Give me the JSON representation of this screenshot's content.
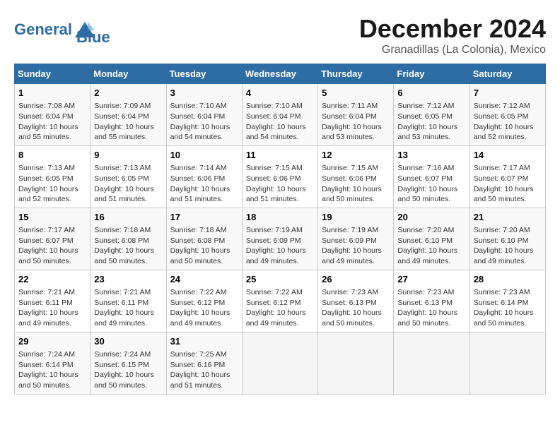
{
  "header": {
    "logo_line1": "General",
    "logo_line2": "Blue",
    "month": "December 2024",
    "location": "Granadillas (La Colonia), Mexico"
  },
  "days_of_week": [
    "Sunday",
    "Monday",
    "Tuesday",
    "Wednesday",
    "Thursday",
    "Friday",
    "Saturday"
  ],
  "weeks": [
    [
      {
        "day": "1",
        "info": "Sunrise: 7:08 AM\nSunset: 6:04 PM\nDaylight: 10 hours\nand 55 minutes."
      },
      {
        "day": "2",
        "info": "Sunrise: 7:09 AM\nSunset: 6:04 PM\nDaylight: 10 hours\nand 55 minutes."
      },
      {
        "day": "3",
        "info": "Sunrise: 7:10 AM\nSunset: 6:04 PM\nDaylight: 10 hours\nand 54 minutes."
      },
      {
        "day": "4",
        "info": "Sunrise: 7:10 AM\nSunset: 6:04 PM\nDaylight: 10 hours\nand 54 minutes."
      },
      {
        "day": "5",
        "info": "Sunrise: 7:11 AM\nSunset: 6:04 PM\nDaylight: 10 hours\nand 53 minutes."
      },
      {
        "day": "6",
        "info": "Sunrise: 7:12 AM\nSunset: 6:05 PM\nDaylight: 10 hours\nand 53 minutes."
      },
      {
        "day": "7",
        "info": "Sunrise: 7:12 AM\nSunset: 6:05 PM\nDaylight: 10 hours\nand 52 minutes."
      }
    ],
    [
      {
        "day": "8",
        "info": "Sunrise: 7:13 AM\nSunset: 6:05 PM\nDaylight: 10 hours\nand 52 minutes."
      },
      {
        "day": "9",
        "info": "Sunrise: 7:13 AM\nSunset: 6:05 PM\nDaylight: 10 hours\nand 51 minutes."
      },
      {
        "day": "10",
        "info": "Sunrise: 7:14 AM\nSunset: 6:06 PM\nDaylight: 10 hours\nand 51 minutes."
      },
      {
        "day": "11",
        "info": "Sunrise: 7:15 AM\nSunset: 6:06 PM\nDaylight: 10 hours\nand 51 minutes."
      },
      {
        "day": "12",
        "info": "Sunrise: 7:15 AM\nSunset: 6:06 PM\nDaylight: 10 hours\nand 50 minutes."
      },
      {
        "day": "13",
        "info": "Sunrise: 7:16 AM\nSunset: 6:07 PM\nDaylight: 10 hours\nand 50 minutes."
      },
      {
        "day": "14",
        "info": "Sunrise: 7:17 AM\nSunset: 6:07 PM\nDaylight: 10 hours\nand 50 minutes."
      }
    ],
    [
      {
        "day": "15",
        "info": "Sunrise: 7:17 AM\nSunset: 6:07 PM\nDaylight: 10 hours\nand 50 minutes."
      },
      {
        "day": "16",
        "info": "Sunrise: 7:18 AM\nSunset: 6:08 PM\nDaylight: 10 hours\nand 50 minutes."
      },
      {
        "day": "17",
        "info": "Sunrise: 7:18 AM\nSunset: 6:08 PM\nDaylight: 10 hours\nand 50 minutes."
      },
      {
        "day": "18",
        "info": "Sunrise: 7:19 AM\nSunset: 6:09 PM\nDaylight: 10 hours\nand 49 minutes."
      },
      {
        "day": "19",
        "info": "Sunrise: 7:19 AM\nSunset: 6:09 PM\nDaylight: 10 hours\nand 49 minutes."
      },
      {
        "day": "20",
        "info": "Sunrise: 7:20 AM\nSunset: 6:10 PM\nDaylight: 10 hours\nand 49 minutes."
      },
      {
        "day": "21",
        "info": "Sunrise: 7:20 AM\nSunset: 6:10 PM\nDaylight: 10 hours\nand 49 minutes."
      }
    ],
    [
      {
        "day": "22",
        "info": "Sunrise: 7:21 AM\nSunset: 6:11 PM\nDaylight: 10 hours\nand 49 minutes."
      },
      {
        "day": "23",
        "info": "Sunrise: 7:21 AM\nSunset: 6:11 PM\nDaylight: 10 hours\nand 49 minutes."
      },
      {
        "day": "24",
        "info": "Sunrise: 7:22 AM\nSunset: 6:12 PM\nDaylight: 10 hours\nand 49 minutes."
      },
      {
        "day": "25",
        "info": "Sunrise: 7:22 AM\nSunset: 6:12 PM\nDaylight: 10 hours\nand 49 minutes."
      },
      {
        "day": "26",
        "info": "Sunrise: 7:23 AM\nSunset: 6:13 PM\nDaylight: 10 hours\nand 50 minutes."
      },
      {
        "day": "27",
        "info": "Sunrise: 7:23 AM\nSunset: 6:13 PM\nDaylight: 10 hours\nand 50 minutes."
      },
      {
        "day": "28",
        "info": "Sunrise: 7:23 AM\nSunset: 6:14 PM\nDaylight: 10 hours\nand 50 minutes."
      }
    ],
    [
      {
        "day": "29",
        "info": "Sunrise: 7:24 AM\nSunset: 6:14 PM\nDaylight: 10 hours\nand 50 minutes."
      },
      {
        "day": "30",
        "info": "Sunrise: 7:24 AM\nSunset: 6:15 PM\nDaylight: 10 hours\nand 50 minutes."
      },
      {
        "day": "31",
        "info": "Sunrise: 7:25 AM\nSunset: 6:16 PM\nDaylight: 10 hours\nand 51 minutes."
      },
      {
        "day": "",
        "info": ""
      },
      {
        "day": "",
        "info": ""
      },
      {
        "day": "",
        "info": ""
      },
      {
        "day": "",
        "info": ""
      }
    ]
  ]
}
